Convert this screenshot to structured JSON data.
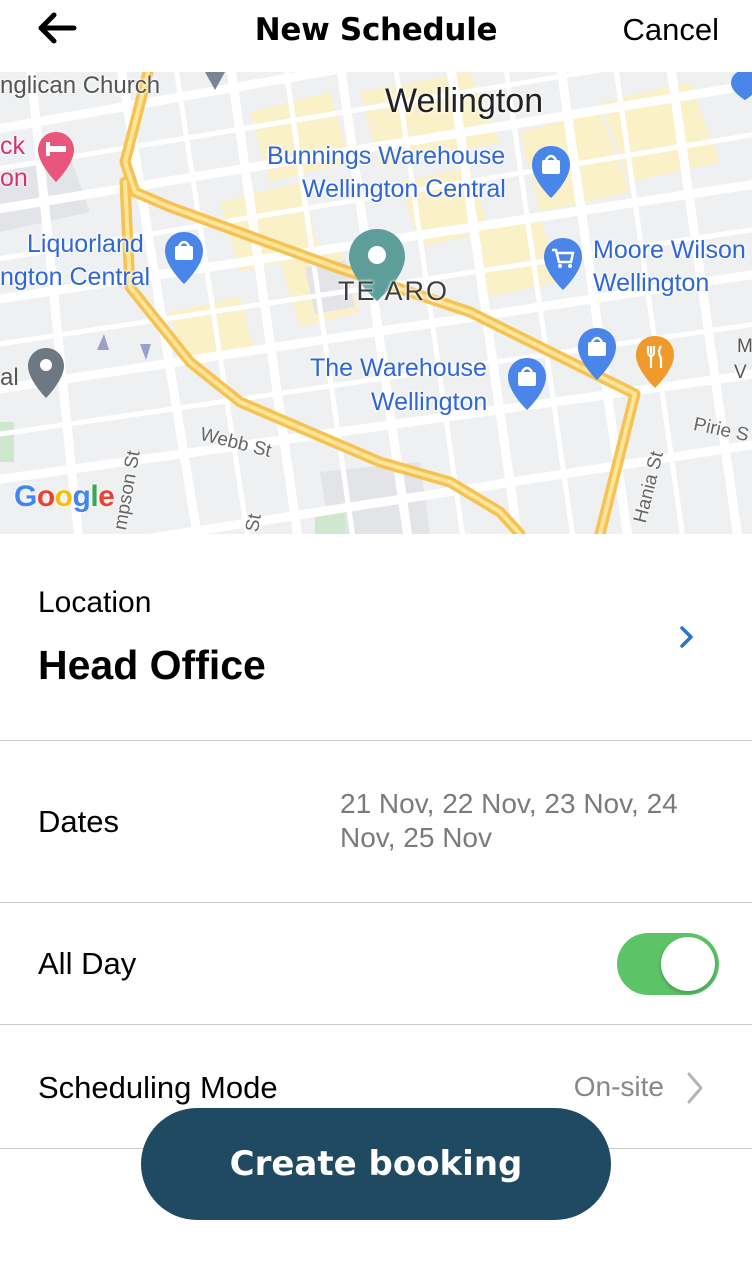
{
  "header": {
    "title": "New Schedule",
    "cancel_label": "Cancel",
    "back_icon": "arrow-left-icon"
  },
  "map": {
    "city_label": "Wellington",
    "district_label": "TE ARO",
    "church_label": "nglican Church",
    "hotel_label_1": "ck",
    "hotel_label_2": "on",
    "bunnings_line1": "Bunnings Warehouse",
    "bunnings_line2": "Wellington Central",
    "liquorland_line1": "Liquorland",
    "liquorland_line2": "ngton Central",
    "moore_line1": "Moore Wilson",
    "moore_line2": "Wellington",
    "warehouse_line1": "The Warehouse",
    "warehouse_line2": "Wellington",
    "street_webb": "Webb St",
    "street_pirie": "Pirie S",
    "street_hania": "Hania St",
    "street_thompson": "mpson St",
    "street_st": "St",
    "edge_label_left": "al",
    "edge_label_right_1": "M",
    "edge_label_right_2": "V",
    "google_logo": "Google",
    "route_color": "#f5c04a",
    "pin_color": "#5e9e9a"
  },
  "location": {
    "label": "Location",
    "value": "Head Office"
  },
  "dates": {
    "label": "Dates",
    "value": "21 Nov, 22 Nov, 23 Nov, 24 Nov, 25 Nov"
  },
  "all_day": {
    "label": "All Day",
    "enabled": true
  },
  "scheduling_mode": {
    "label": "Scheduling Mode",
    "value": "On-site"
  },
  "cta": {
    "label": "Create booking"
  },
  "colors": {
    "toggle_on": "#5cc466",
    "cta_bg": "#1f4a61",
    "accent_blue": "#2f67d8"
  }
}
